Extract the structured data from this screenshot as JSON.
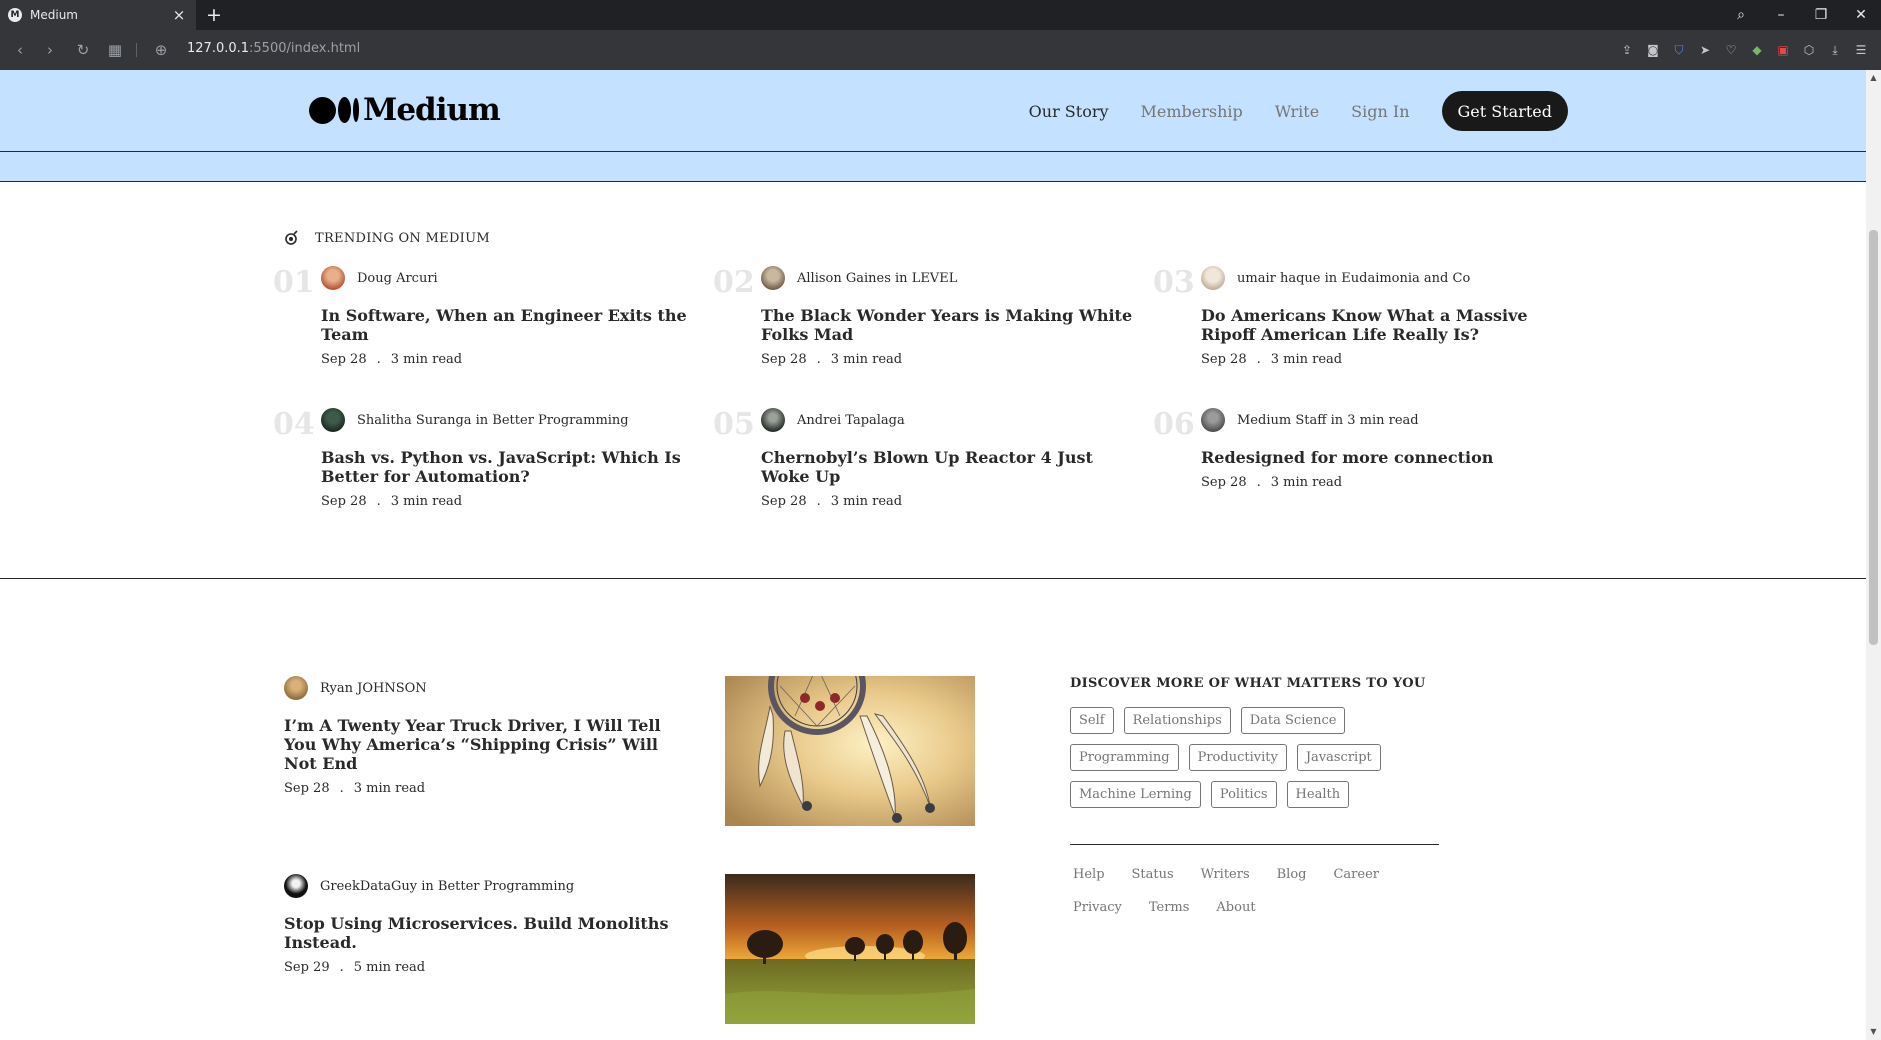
{
  "browser": {
    "tab_title": "Medium",
    "url_host": "127.0.0.1",
    "url_rest": ":5500/index.html"
  },
  "header": {
    "logo_text": "Medium",
    "nav": [
      "Our Story",
      "Membership",
      "Write",
      "Sign In"
    ],
    "cta": "Get Started",
    "bg_color": "#c4e2ff"
  },
  "trending": {
    "label": "TRENDING ON MEDIUM",
    "items": [
      {
        "num": "01",
        "author": "Doug Arcuri",
        "title": "In Software, When an Engineer Exits the Team",
        "date": "Sep 28",
        "read": "3 min read"
      },
      {
        "num": "02",
        "author": "Allison Gaines in LEVEL",
        "title": "The Black Wonder Years is Making White Folks Mad",
        "date": "Sep 28",
        "read": "3 min read"
      },
      {
        "num": "03",
        "author": "umair haque in Eudaimonia and Co",
        "title": "Do Americans Know What a Massive Ripoff American Life Really Is?",
        "date": "Sep 28",
        "read": "3 min read"
      },
      {
        "num": "04",
        "author": "Shalitha Suranga in Better Programming",
        "title": "Bash vs. Python vs. JavaScript: Which Is Better for Automation?",
        "date": "Sep 28",
        "read": "3 min read"
      },
      {
        "num": "05",
        "author": "Andrei Tapalaga",
        "title": "Chernobyl’s Blown Up Reactor 4 Just Woke Up",
        "date": "Sep 28",
        "read": "3 min read"
      },
      {
        "num": "06",
        "author": "Medium Staff in 3 min read",
        "title": "Redesigned for more connection",
        "date": "Sep 28",
        "read": "3 min read"
      }
    ]
  },
  "separator": ".",
  "posts": [
    {
      "author": "Ryan JOHNSON",
      "title": "I’m A Twenty Year Truck Driver, I Will Tell You Why America’s “Shipping Crisis” Will Not End",
      "date": "Sep 28",
      "read": "3 min read",
      "image": "dreamcatcher-photo"
    },
    {
      "author": "GreekDataGuy in Better Programming",
      "title": "Stop Using Microservices. Build Monoliths Instead.",
      "date": "Sep 29",
      "read": "5 min read",
      "image": "sunset-field-photo"
    }
  ],
  "sidebar": {
    "title": "DISCOVER MORE OF WHAT MATTERS TO YOU",
    "tags": [
      "Self",
      "Relationships",
      "Data Science",
      "Programming",
      "Productivity",
      "Javascript",
      "Machine Lerning",
      "Politics",
      "Health"
    ],
    "footer_links": [
      "Help",
      "Status",
      "Writers",
      "Blog",
      "Career",
      "Privacy",
      "Terms",
      "About"
    ]
  }
}
